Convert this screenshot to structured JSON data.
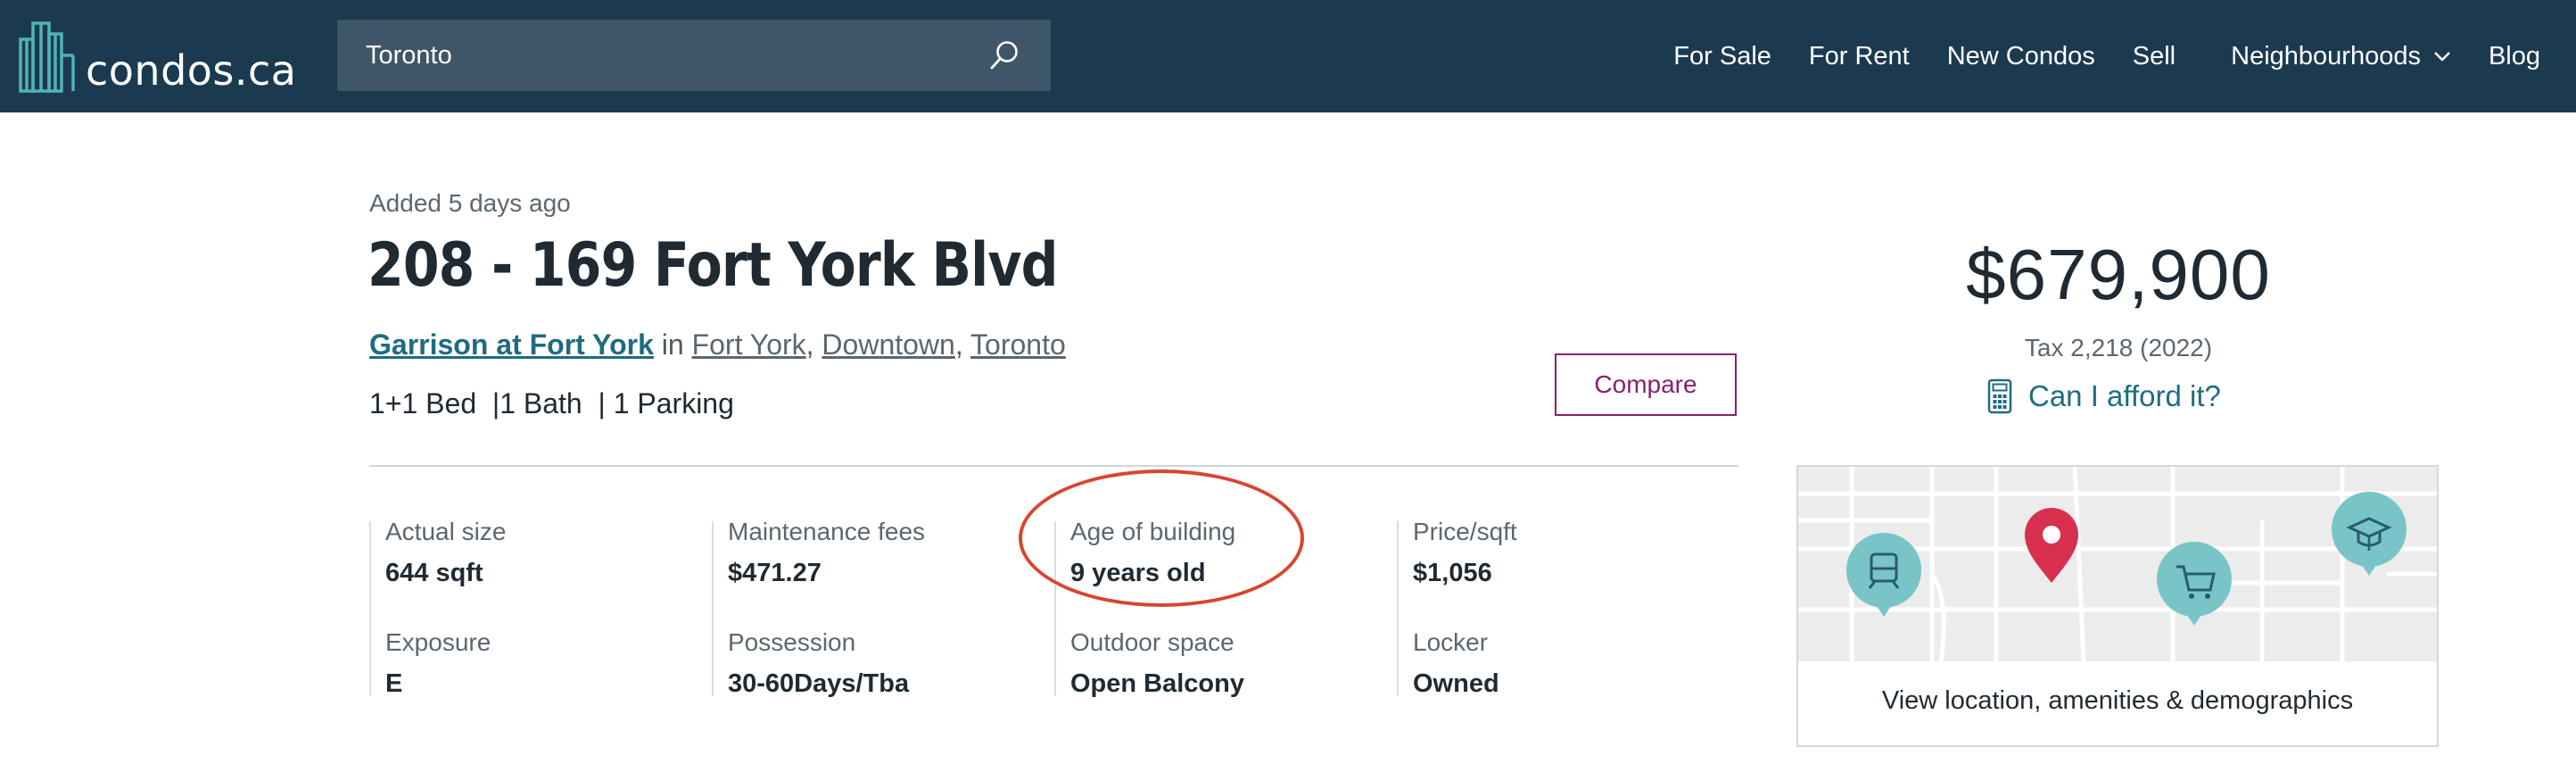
{
  "header": {
    "logo_text": "condos.ca",
    "search": {
      "value": "Toronto",
      "placeholder": ""
    },
    "nav": [
      {
        "label": "For Sale"
      },
      {
        "label": "For Rent"
      },
      {
        "label": "New Condos"
      },
      {
        "label": "Sell"
      },
      {
        "label": "Neighbourhoods"
      },
      {
        "label": "Blog"
      }
    ]
  },
  "listing": {
    "added": "Added 5 days ago",
    "title": "208 - 169 Fort York Blvd",
    "building": "Garrison at Fort York",
    "in_text": " in ",
    "neighbourhoods": [
      "Fort York",
      "Downtown",
      "Toronto"
    ],
    "separator": ", ",
    "specs": "1+1 Bed  |1 Bath  | 1 Parking",
    "compare_label": "Compare"
  },
  "facts": [
    {
      "label": "Actual size",
      "value": "644 sqft"
    },
    {
      "label": "Maintenance fees",
      "value": "$471.27"
    },
    {
      "label": "Age of building",
      "value": "9 years old"
    },
    {
      "label": "Price/sqft",
      "value": "$1,056"
    },
    {
      "label": "Exposure",
      "value": "E"
    },
    {
      "label": "Possession",
      "value": "30-60Days/Tba"
    },
    {
      "label": "Outdoor space",
      "value": "Open Balcony"
    },
    {
      "label": "Locker",
      "value": "Owned"
    }
  ],
  "price": {
    "amount": "$679,900",
    "tax": "Tax 2,218 (2022)",
    "afford_label": "Can I afford it?"
  },
  "map_card": {
    "caption": "View location, amenities & demographics",
    "icons": [
      "transit-icon",
      "location-pin-icon",
      "shopping-cart-icon",
      "school-icon"
    ]
  },
  "colors": {
    "header_bg": "#1b3a4f",
    "accent_teal": "#1f6b80",
    "compare_purple": "#8a1f6e",
    "annotation_red": "#d9452f",
    "pin_red": "#d92f4f",
    "map_bubble": "#79c4c6"
  }
}
